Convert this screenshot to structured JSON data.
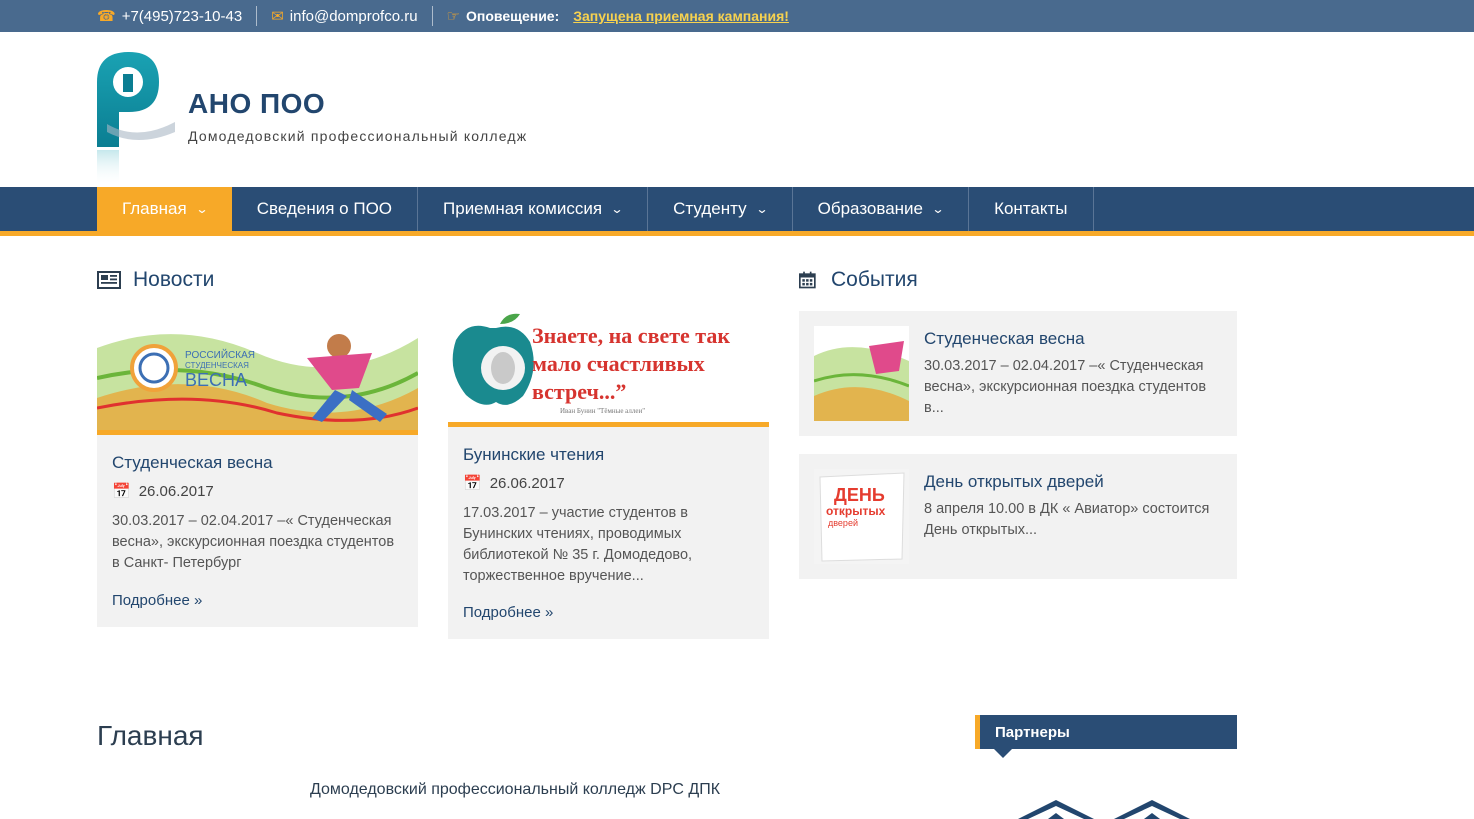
{
  "topbar": {
    "phone": "+7(495)723-10-43",
    "email": "info@domprofco.ru",
    "alert_label": "Оповещение:",
    "alert_link": "Запущена приемная кампания!",
    "icons": [
      "phone-icon",
      "envelope-icon",
      "hand-pointing-icon"
    ]
  },
  "header": {
    "title": "АНО ПОО",
    "subtitle": "Домодедовский профессиональный колледж"
  },
  "nav": {
    "items": [
      {
        "label": "Главная",
        "dropdown": true,
        "active": true
      },
      {
        "label": "Сведения о ПОО",
        "dropdown": false
      },
      {
        "label": "Приемная комиссия",
        "dropdown": true
      },
      {
        "label": "Студенту",
        "dropdown": true
      },
      {
        "label": "Образование",
        "dropdown": true
      },
      {
        "label": "Контакты",
        "dropdown": false
      }
    ]
  },
  "news": {
    "title": "Новости",
    "read_more": "Подробнее »",
    "items": [
      {
        "title": "Студенческая весна",
        "date": "26.06.2017",
        "excerpt": "30.03.2017 – 02.04.2017 –« Студенческая весна», экскурсионная поездка студентов в Санкт- Петербург",
        "image_text": [
          "РОССИЙСКАЯ",
          "СТУДЕНЧЕСКАЯ",
          "ВЕСНА"
        ]
      },
      {
        "title": "Бунинские чтения",
        "date": "26.06.2017",
        "excerpt": "17.03.2017 – участие студентов в Бунинских чтениях, проводимых библиотекой № 35 г. Домодедово, торжественное вручение...",
        "image_text": [
          "Знаете, на свете так",
          "мало счастливых",
          "встреч...”",
          "Иван Бунин \"Тёмные аллеи\""
        ]
      }
    ]
  },
  "events": {
    "title": "События",
    "items": [
      {
        "title": "Студенческая весна",
        "text": "30.03.2017 – 02.04.2017 –« Студенческая весна», экскурсионная поездка студентов в..."
      },
      {
        "title": "День открытых дверей",
        "text": "8 апреля 10.00 в ДК « Авиатор» состоится День открытых...",
        "image_text": [
          "ДЕНЬ",
          "открытых",
          "дверей"
        ]
      }
    ]
  },
  "main": {
    "title": "Главная",
    "subtitle": "Домодедовский профессиональный колледж DPC ДПК"
  },
  "partners": {
    "title": "Партнеры"
  },
  "colors": {
    "topbar": "#496a8e",
    "nav": "#2a4d75",
    "accent": "#f7a928",
    "title": "#22466e"
  }
}
